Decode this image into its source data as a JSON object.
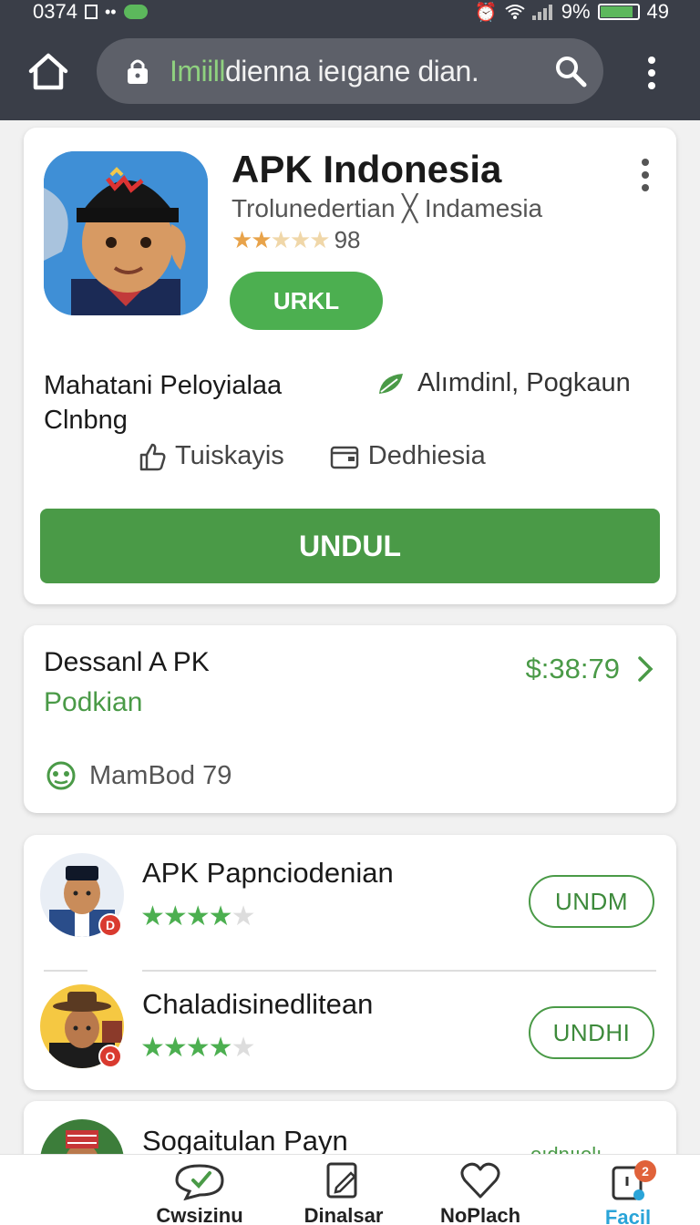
{
  "status_bar": {
    "time": "0374",
    "battery": "9%",
    "extra": "49",
    "battery_level": 0.9
  },
  "browser": {
    "url_highlight": "Imiill",
    "url_rest": "dienna ieıgane dian."
  },
  "app": {
    "title": "APK Indonesia",
    "subtitle": "Trolunedertian ╳ Indamesia",
    "rating_count": "98",
    "rating_stars": 2.5,
    "small_button": "URKL",
    "developer": "Mahatani Peloyialaa Clnbng",
    "category": "Alımdinl, Pogkaun",
    "meta1": "Tuiskayis",
    "meta2": "Dedhiesia",
    "download_button": "UNDUL"
  },
  "detail_card": {
    "title": "Dessanl A PK",
    "subtitle": "Podkian",
    "price": "$:38:79",
    "meta": "MamBod 79"
  },
  "list": [
    {
      "title": "APK Papnciodenian",
      "stars": 4.5,
      "button": "UNDM",
      "badge": "D"
    },
    {
      "title": "Chaladisinedlitean",
      "stars": 4.5,
      "button": "UNDHI",
      "badge": "O"
    }
  ],
  "partial_card": {
    "title": "Sogaitulan Payn",
    "link": "oıdnııolı"
  },
  "bottom_nav": [
    {
      "label": "Cwsizinu",
      "icon": "chat-check-icon"
    },
    {
      "label": "Dinalsar",
      "icon": "edit-icon"
    },
    {
      "label": "NoPlach",
      "icon": "heart-icon"
    },
    {
      "label": "Facil",
      "icon": "notification-icon",
      "badge": "2",
      "active": true
    }
  ],
  "colors": {
    "accent_green": "#4a9a47",
    "topbar": "#3a3e48",
    "active_nav": "#2aa4d8"
  }
}
